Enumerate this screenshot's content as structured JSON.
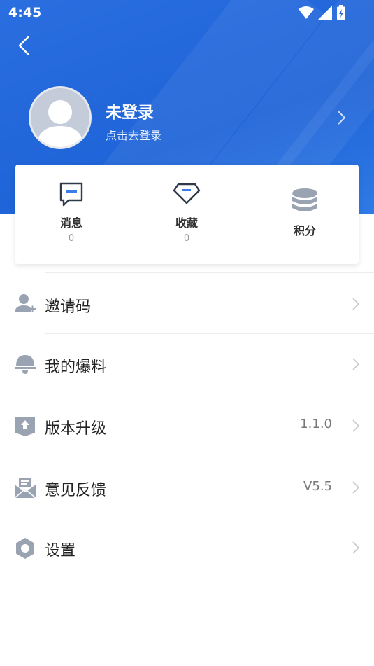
{
  "status_bar": {
    "time": "4:45"
  },
  "profile": {
    "name": "未登录",
    "subtitle": "点击去登录"
  },
  "stats": [
    {
      "label": "消息",
      "count": "0",
      "icon": "message-icon"
    },
    {
      "label": "收藏",
      "count": "0",
      "icon": "diamond-icon"
    },
    {
      "label": "积分",
      "icon": "coins-icon"
    }
  ],
  "menu": [
    {
      "label": "邀请码",
      "value": "",
      "icon": "user-add-icon"
    },
    {
      "label": "我的爆料",
      "value": "",
      "icon": "bell-icon"
    },
    {
      "label": "版本升级",
      "value": "1.1.0",
      "icon": "upgrade-icon"
    },
    {
      "label": "意见反馈",
      "value": "V5.5",
      "icon": "mail-icon"
    },
    {
      "label": "设置",
      "value": "",
      "icon": "settings-icon"
    }
  ],
  "colors": {
    "header": "#2266dd",
    "accent": "#3a7de8",
    "icon_gray": "#9aa3b2"
  }
}
